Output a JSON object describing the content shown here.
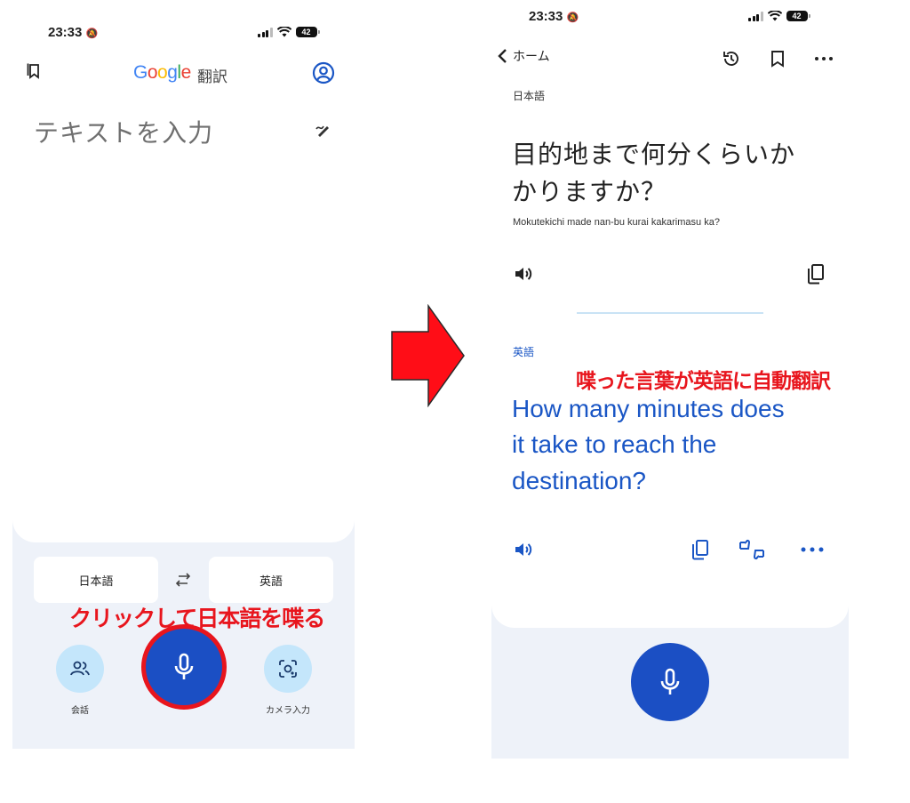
{
  "left_screen": {
    "status": {
      "time": "23:33",
      "battery": "42"
    },
    "header": {
      "logo": "Google",
      "title": "翻訳"
    },
    "input": {
      "placeholder": "テキストを入力"
    },
    "languages": {
      "source": "日本語",
      "target": "英語"
    },
    "actions": {
      "conversation_label": "会話",
      "camera_label": "カメラ入力"
    },
    "annotation": "クリックして日本語を喋る"
  },
  "right_screen": {
    "status": {
      "time": "23:33",
      "battery": "42"
    },
    "nav": {
      "back_label": "ホーム"
    },
    "source": {
      "language": "日本語",
      "text_line1": "目的地まで何分くらいか",
      "text_line2": "かりますか？",
      "romanization": "Mokutekichi made nan-bu kurai kakarimasu ka?"
    },
    "target": {
      "language": "英語",
      "text_line1": "How many minutes does",
      "text_line2": "it take to reach the",
      "text_line3": "destination?"
    },
    "annotation": "喋った言葉が英語に自動翻訳"
  },
  "colors": {
    "accent_blue": "#1a56c5",
    "mic_blue": "#1b4fc4",
    "highlight_red": "#e8151d",
    "arrow_red": "#ff0d17",
    "panel_bg": "#eef2f9",
    "light_blue_button": "#c4e6fb"
  },
  "icons": [
    "bookmark-icon",
    "account-icon",
    "handwriting-icon",
    "swap-icon",
    "people-icon",
    "mic-icon",
    "lens-icon",
    "back-chevron-icon",
    "history-icon",
    "bookmark-outline-icon",
    "more-icon",
    "speaker-icon",
    "copy-icon",
    "feedback-icon"
  ]
}
